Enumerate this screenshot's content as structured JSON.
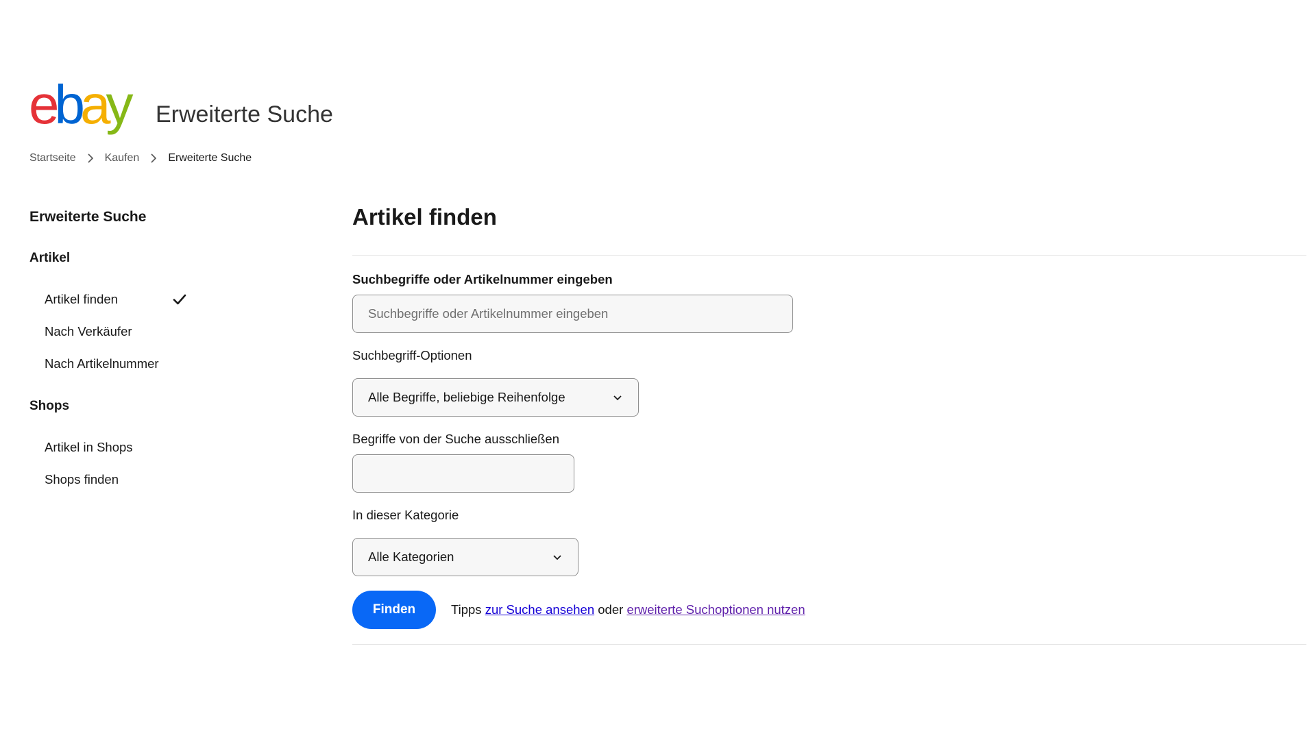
{
  "logo": {
    "letters": [
      "e",
      "b",
      "a",
      "y"
    ],
    "colors": [
      "#e53238",
      "#0064d2",
      "#f5af02",
      "#86b817"
    ]
  },
  "header": {
    "title": "Erweiterte Suche"
  },
  "breadcrumb": {
    "items": [
      "Startseite",
      "Kaufen",
      "Erweiterte Suche"
    ],
    "separator_icon": "chevron-right-icon"
  },
  "sidebar": {
    "title": "Erweiterte Suche",
    "groups": [
      {
        "label": "Artikel",
        "items": [
          "Artikel finden",
          "Nach Verkäufer",
          "Nach Artikelnummer"
        ]
      },
      {
        "label": "Shops",
        "items": [
          "Artikel in Shops",
          "Shops finden"
        ]
      }
    ],
    "active_item": "Artikel finden",
    "active_icon": "checkmark-icon"
  },
  "main": {
    "title": "Artikel finden",
    "keywords": {
      "label": "Suchbegriffe oder Artikelnummer eingeben",
      "placeholder": "Suchbegriffe oder Artikelnummer eingeben",
      "value": ""
    },
    "keyword_options": {
      "label": "Suchbegriff-Optionen",
      "selected": "Alle Begriffe, beliebige Reihenfolge"
    },
    "exclude": {
      "label": "Begriffe von der Suche ausschließen",
      "value": ""
    },
    "category": {
      "label": "In dieser Kategorie",
      "selected": "Alle Kategorien"
    },
    "submit_label": "Finden",
    "tips": {
      "prefix": "Tipps",
      "link1": "zur Suche ansehen",
      "middle": "oder",
      "link2": "erweiterte Suchoptionen nutzen"
    }
  },
  "colors": {
    "primary_button": "#0968f6",
    "link": "#1500d6",
    "visited_link": "#5e1faa",
    "text": "#191919"
  }
}
